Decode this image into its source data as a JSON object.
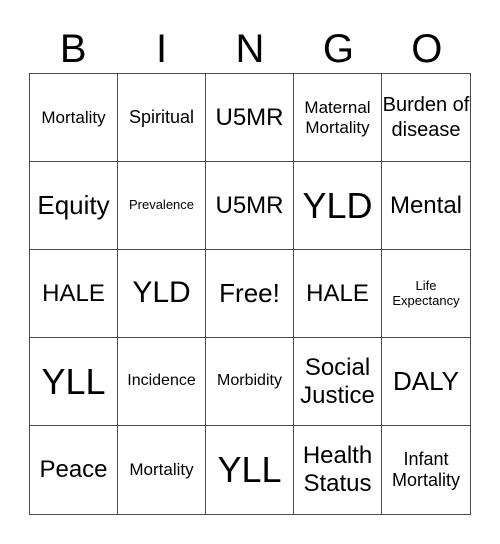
{
  "header": {
    "letters": [
      "B",
      "I",
      "N",
      "G",
      "O"
    ]
  },
  "board": {
    "cells": [
      "Mortality",
      "Spiritual",
      "U5MR",
      "Maternal Mortality",
      "Burden of disease",
      "Equity",
      "Prevalence",
      "U5MR",
      "YLD",
      "Mental",
      "HALE",
      "YLD",
      "Free!",
      "HALE",
      "Life Expectancy",
      "YLL",
      "Incidence",
      "Morbidity",
      "Social Justice",
      "DALY",
      "Peace",
      "Mortality",
      "YLL",
      "Health Status",
      "Infant Mortality"
    ],
    "free_space_index": 12
  }
}
